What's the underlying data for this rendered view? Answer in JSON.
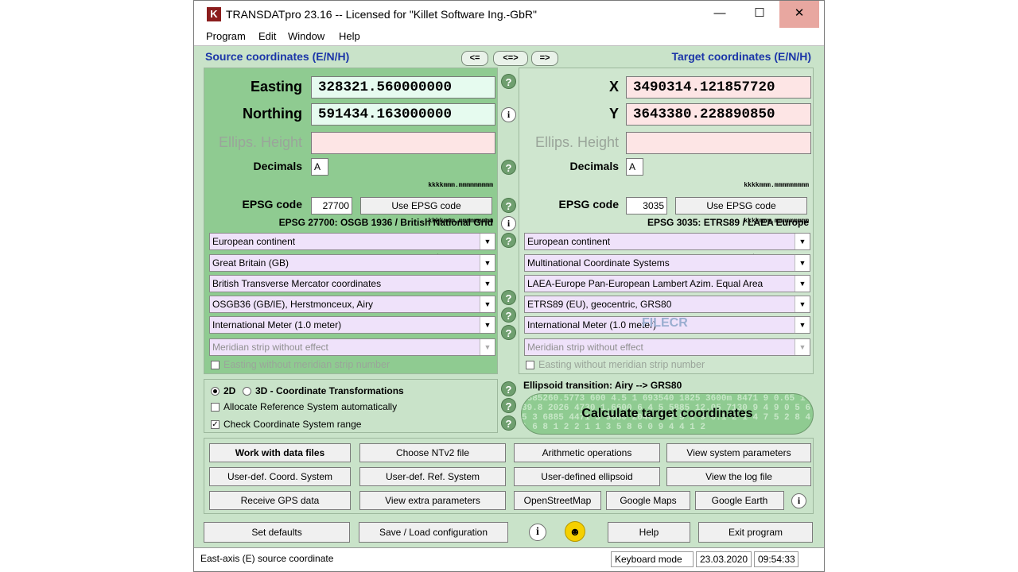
{
  "window": {
    "title": "TRANSDATpro 23.16 -- Licensed for \"Killet Software Ing.-GbR\"",
    "app_icon": "K",
    "minimize": "—",
    "maximize": "☐",
    "close": "✕"
  },
  "menu": [
    "Program",
    "Edit",
    "Window",
    "Help"
  ],
  "headers": {
    "source": "Source coordinates (E/N/H)",
    "target": "Target coordinates (E/N/H)"
  },
  "arrows": [
    "<=",
    "<=>",
    "=>"
  ],
  "source": {
    "easting_label": "Easting",
    "easting_value": "328321.560000000",
    "northing_label": "Northing",
    "northing_value": "591434.163000000",
    "height_label": "Ellips. Height",
    "height_value": "",
    "decimals_label": "Decimals",
    "decimals_value": "A",
    "format_lines": [
      "kkkkmmm.mmmmmmmmm",
      "kkkkmmm.mmmmmmmmm",
      "±mmmm.mmmmmmmmm"
    ],
    "epsg_label": "EPSG code",
    "epsg_value": "27700",
    "epsg_button": "Use EPSG code",
    "epsg_desc": "EPSG 27700: OSGB 1936 / British National Grid",
    "selects": [
      "European continent",
      "Great Britain (GB)",
      "British Transverse Mercator coordinates",
      "OSGB36 (GB/IE), Herstmonceux, Airy",
      "International Meter (1.0 meter)",
      "Meridian strip without effect"
    ],
    "strip_check": "Easting without meridian strip number"
  },
  "target": {
    "x_label": "X",
    "x_value": "3490314.121857720",
    "y_label": "Y",
    "y_value": "3643380.228890850",
    "height_label": "Ellips. Height",
    "height_value": "",
    "decimals_label": "Decimals",
    "decimals_value": "A",
    "format_lines": [
      "kkkkmmm.mmmmmmmmm",
      "kkkkmmm.mmmmmmmmm",
      "±mmmm.mmmmmmmmm"
    ],
    "epsg_label": "EPSG code",
    "epsg_value": "3035",
    "epsg_button": "Use EPSG code",
    "epsg_desc": "EPSG 3035: ETRS89 / LAEA Europe",
    "selects": [
      "European continent",
      "Multinational Coordinate Systems",
      "LAEA-Europe Pan-European Lambert Azim. Equal Area",
      "ETRS89 (EU), geocentric, GRS80",
      "International Meter (1.0 meter)",
      "Meridian strip without effect"
    ],
    "strip_check": "Easting without meridian strip number"
  },
  "options": {
    "mode_2d": "2D",
    "mode_3d": "3D - Coordinate Transformations",
    "allocate": "Allocate Reference System automatically",
    "check_range": "Check Coordinate System range"
  },
  "ellipsoid_transition": "Ellipsoid transition: Airy --> GRS80",
  "calculate": "Calculate target coordinates",
  "calc_pattern": "1885260.5773 600 4.5 1 693540 1825 3600m 8471 9 0.65 1 39.8 2026 4730 1.6600 6 4 5 5885 12.05 7130 9 4 9 0 5 6 5 3 6885 4471 5 9600 2046 3 2 5 1 9 0.1 2 1 4 7 5 2 8 4 1 6 8 1 2 2 1 1 3 5 8 6 0 9 4 4 1 2",
  "buttons": {
    "row1": [
      "Work with data files",
      "Choose NTv2 file",
      "Arithmetic operations",
      "View system parameters"
    ],
    "row2": [
      "User-def. Coord. System",
      "User-def. Ref. System",
      "User-defined ellipsoid",
      "View the log file"
    ],
    "row3": [
      "Receive GPS data",
      "View extra parameters",
      "OpenStreetMap",
      "Google Maps",
      "Google Earth"
    ],
    "set_defaults": "Set defaults",
    "save_load": "Save / Load configuration",
    "help": "Help",
    "exit": "Exit program"
  },
  "status": {
    "message": "East-axis (E) source coordinate",
    "mode": "Keyboard mode",
    "date": "23.03.2020",
    "time": "09:54:33"
  },
  "watermark": "FILECR"
}
